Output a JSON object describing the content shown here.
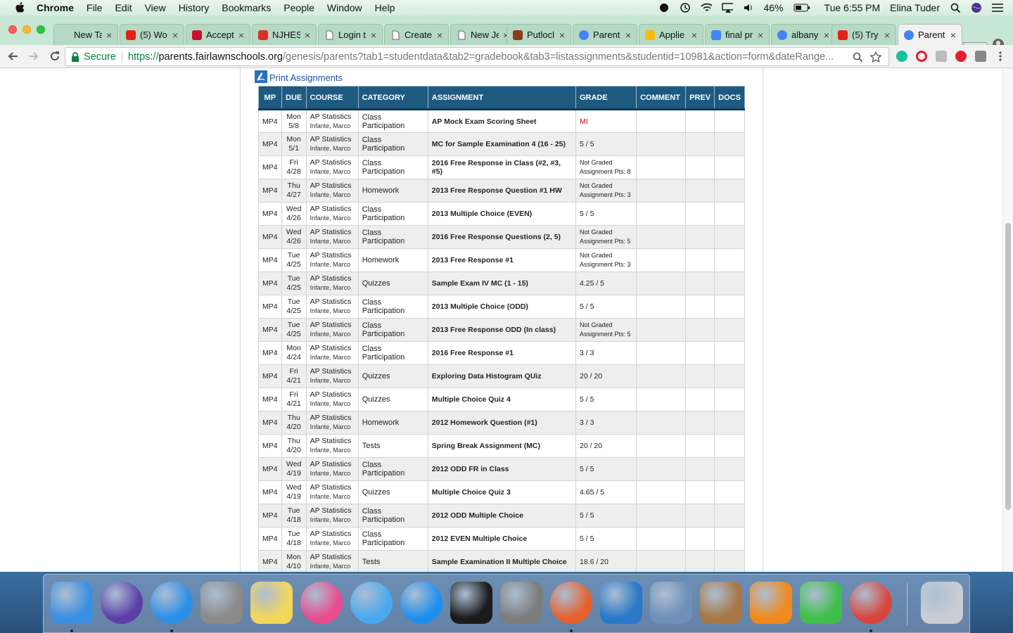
{
  "menubar": {
    "app_name": "Chrome",
    "items": [
      "File",
      "Edit",
      "View",
      "History",
      "Bookmarks",
      "People",
      "Window",
      "Help"
    ],
    "battery": "46%",
    "clock": "Tue 6:55 PM",
    "user": "Elina Tuder"
  },
  "tabs": [
    {
      "title": "New Tab",
      "icon": "blank-icon"
    },
    {
      "title": "(5) Wo",
      "icon": "youtube-icon"
    },
    {
      "title": "Accept",
      "icon": "ccc-icon"
    },
    {
      "title": "NJHES",
      "icon": "gmail-icon"
    },
    {
      "title": "Login t",
      "icon": "page-icon"
    },
    {
      "title": "Create",
      "icon": "page-icon"
    },
    {
      "title": "New Je",
      "icon": "page-icon"
    },
    {
      "title": "Putlocl",
      "icon": "film-icon"
    },
    {
      "title": "Parent",
      "icon": "google-icon"
    },
    {
      "title": "Applie",
      "icon": "drive-icon"
    },
    {
      "title": "final pr",
      "icon": "docs-icon"
    },
    {
      "title": "albany",
      "icon": "google-icon"
    },
    {
      "title": "(5) Try",
      "icon": "youtube-icon"
    },
    {
      "title": "Parent",
      "icon": "google-icon"
    }
  ],
  "toolbar": {
    "secure_label": "Secure",
    "url_scheme": "https://",
    "url_host": "parents.fairlawnschools.org",
    "url_path": "/genesis/parents?tab1=studentdata&tab2=gradebook&tab3=listassignments&studentid=10981&action=form&dateRange..."
  },
  "page": {
    "print_link": "Print Assignments"
  },
  "table": {
    "headers": [
      "MP",
      "DUE",
      "COURSE",
      "CATEGORY",
      "ASSIGNMENT",
      "GRADE",
      "COMMENT",
      "PREV",
      "DOCS"
    ],
    "rows": [
      {
        "mp": "MP4",
        "day": "Mon",
        "date": "5/8",
        "course": "AP Statistics",
        "teacher": "Infante, Marco",
        "category": "Class Participation",
        "assignment": "AP Mock Exam Scoring Sheet",
        "grade": "MI",
        "grade_type": "mi"
      },
      {
        "mp": "MP4",
        "day": "Mon",
        "date": "5/1",
        "course": "AP Statistics",
        "teacher": "Infante, Marco",
        "category": "Class Participation",
        "assignment": "MC for Sample Examination 4 (16 - 25)",
        "grade": "5 / 5",
        "grade_type": "score"
      },
      {
        "mp": "MP4",
        "day": "Fri",
        "date": "4/28",
        "course": "AP Statistics",
        "teacher": "Infante, Marco",
        "category": "Class Participation",
        "assignment": "2016 Free Response in Class (#2, #3, #5)",
        "grade": "Not Graded",
        "grade_sub": "Assignment Pts: 8",
        "grade_type": "ng"
      },
      {
        "mp": "MP4",
        "day": "Thu",
        "date": "4/27",
        "course": "AP Statistics",
        "teacher": "Infante, Marco",
        "category": "Homework",
        "assignment": "2013 Free Response Question #1 HW",
        "grade": "Not Graded",
        "grade_sub": "Assignment Pts: 3",
        "grade_type": "ng"
      },
      {
        "mp": "MP4",
        "day": "Wed",
        "date": "4/26",
        "course": "AP Statistics",
        "teacher": "Infante, Marco",
        "category": "Class Participation",
        "assignment": "2013 Multiple Choice (EVEN)",
        "grade": "5 / 5",
        "grade_type": "score"
      },
      {
        "mp": "MP4",
        "day": "Wed",
        "date": "4/26",
        "course": "AP Statistics",
        "teacher": "Infante, Marco",
        "category": "Class Participation",
        "assignment": "2016 Free Response Questions (2, 5)",
        "grade": "Not Graded",
        "grade_sub": "Assignment Pts: 5",
        "grade_type": "ng"
      },
      {
        "mp": "MP4",
        "day": "Tue",
        "date": "4/25",
        "course": "AP Statistics",
        "teacher": "Infante, Marco",
        "category": "Homework",
        "assignment": "2013 Free Response #1",
        "grade": "Not Graded",
        "grade_sub": "Assignment Pts: 3",
        "grade_type": "ng"
      },
      {
        "mp": "MP4",
        "day": "Tue",
        "date": "4/25",
        "course": "AP Statistics",
        "teacher": "Infante, Marco",
        "category": "Quizzes",
        "assignment": "Sample Exam IV MC (1 - 15)",
        "grade": "4.25 / 5",
        "grade_type": "score"
      },
      {
        "mp": "MP4",
        "day": "Tue",
        "date": "4/25",
        "course": "AP Statistics",
        "teacher": "Infante, Marco",
        "category": "Class Participation",
        "assignment": "2013 Multiple Choice (ODD)",
        "grade": "5 / 5",
        "grade_type": "score"
      },
      {
        "mp": "MP4",
        "day": "Tue",
        "date": "4/25",
        "course": "AP Statistics",
        "teacher": "Infante, Marco",
        "category": "Class Participation",
        "assignment": "2013 Free Response ODD (In class)",
        "grade": "Not Graded",
        "grade_sub": "Assignment Pts: 5",
        "grade_type": "ng"
      },
      {
        "mp": "MP4",
        "day": "Mon",
        "date": "4/24",
        "course": "AP Statistics",
        "teacher": "Infante, Marco",
        "category": "Class Participation",
        "assignment": "2016 Free Response #1",
        "grade": "3 / 3",
        "grade_type": "score"
      },
      {
        "mp": "MP4",
        "day": "Fri",
        "date": "4/21",
        "course": "AP Statistics",
        "teacher": "Infante, Marco",
        "category": "Quizzes",
        "assignment": "Exploring Data Histogram QUiz",
        "grade": "20 / 20",
        "grade_type": "score"
      },
      {
        "mp": "MP4",
        "day": "Fri",
        "date": "4/21",
        "course": "AP Statistics",
        "teacher": "Infante, Marco",
        "category": "Quizzes",
        "assignment": "Multiple Choice Quiz 4",
        "grade": "5 / 5",
        "grade_type": "score"
      },
      {
        "mp": "MP4",
        "day": "Thu",
        "date": "4/20",
        "course": "AP Statistics",
        "teacher": "Infante, Marco",
        "category": "Homework",
        "assignment": "2012 Homework Question (#1)",
        "grade": "3 / 3",
        "grade_type": "score"
      },
      {
        "mp": "MP4",
        "day": "Thu",
        "date": "4/20",
        "course": "AP Statistics",
        "teacher": "Infante, Marco",
        "category": "Tests",
        "assignment": "Spring Break Assignment (MC)",
        "grade": "20 / 20",
        "grade_type": "score"
      },
      {
        "mp": "MP4",
        "day": "Wed",
        "date": "4/19",
        "course": "AP Statistics",
        "teacher": "Infante, Marco",
        "category": "Class Participation",
        "assignment": "2012 ODD FR in Class",
        "grade": "5 / 5",
        "grade_type": "score"
      },
      {
        "mp": "MP4",
        "day": "Wed",
        "date": "4/19",
        "course": "AP Statistics",
        "teacher": "Infante, Marco",
        "category": "Quizzes",
        "assignment": "Multiple Choice Quiz 3",
        "grade": "4.65 / 5",
        "grade_type": "score"
      },
      {
        "mp": "MP4",
        "day": "Tue",
        "date": "4/18",
        "course": "AP Statistics",
        "teacher": "Infante, Marco",
        "category": "Class Participation",
        "assignment": "2012 ODD Multiple Choice",
        "grade": "5 / 5",
        "grade_type": "score"
      },
      {
        "mp": "MP4",
        "day": "Tue",
        "date": "4/18",
        "course": "AP Statistics",
        "teacher": "Infante, Marco",
        "category": "Class Participation",
        "assignment": "2012 EVEN Multiple Choice",
        "grade": "5 / 5",
        "grade_type": "score"
      },
      {
        "mp": "MP4",
        "day": "Mon",
        "date": "4/10",
        "course": "AP Statistics",
        "teacher": "Infante, Marco",
        "category": "Tests",
        "assignment": "Sample Examination II Multiple Choice",
        "grade": "18.6 / 20",
        "grade_type": "score"
      }
    ]
  },
  "dock": {
    "apps": [
      {
        "name": "finder",
        "color": "#3c8fe0",
        "running": true
      },
      {
        "name": "siri",
        "color": "#5b3fa8",
        "running": false
      },
      {
        "name": "safari",
        "color": "#2b8fe8",
        "running": true
      },
      {
        "name": "calculator",
        "color": "#8a8a8a",
        "running": false
      },
      {
        "name": "notes",
        "color": "#f4d75a",
        "running": false
      },
      {
        "name": "itunes",
        "color": "#e84c8f",
        "running": false
      },
      {
        "name": "messages",
        "color": "#4aa8f0",
        "running": false
      },
      {
        "name": "app-store",
        "color": "#1e8fef",
        "running": false
      },
      {
        "name": "activity-monitor",
        "color": "#1b1b1b",
        "running": false
      },
      {
        "name": "system-preferences",
        "color": "#7c7c7c",
        "running": false
      },
      {
        "name": "firefox",
        "color": "#e6602b",
        "running": true
      },
      {
        "name": "word",
        "color": "#2a78c8",
        "running": false
      },
      {
        "name": "preview",
        "color": "#6d8fb8",
        "running": false
      },
      {
        "name": "contacts",
        "color": "#a87744",
        "running": false
      },
      {
        "name": "vlc",
        "color": "#f08a1c",
        "running": false
      },
      {
        "name": "facetime",
        "color": "#3fbf4a",
        "running": false
      },
      {
        "name": "chrome",
        "color": "#d8453c",
        "running": true
      },
      {
        "name": "trash",
        "color": "#c9ced4",
        "running": false
      }
    ]
  }
}
